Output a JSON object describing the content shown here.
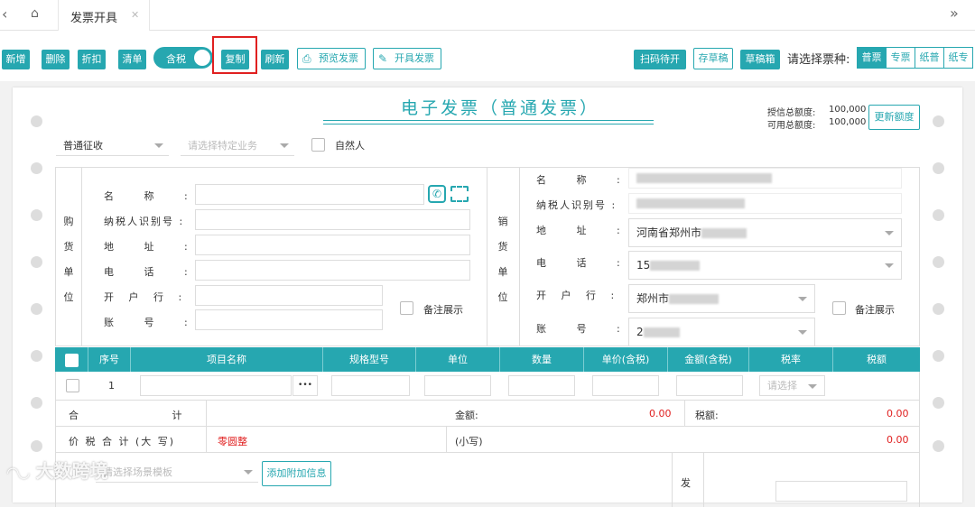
{
  "tabs": {
    "active_label": "发票开具"
  },
  "toolbar": {
    "add": "新增",
    "delete": "删除",
    "discount": "折扣",
    "list": "清单",
    "tax_toggle": "含税",
    "copy": "复制",
    "refresh": "刷新",
    "preview": "预览发票",
    "issue": "开具发票",
    "scan_pending": "扫码待开",
    "save_draft": "存草稿",
    "draft_box": "草稿箱",
    "ticket_type_label": "请选择票种:",
    "ticket_types": [
      "普票",
      "专票",
      "纸普",
      "纸专"
    ],
    "selected_ticket_type": "普票"
  },
  "invoice": {
    "title": "电子发票（普通发票）",
    "quota_credit_label": "授信总额度:",
    "quota_credit_value": "100,000",
    "quota_avail_label": "可用总额度:",
    "quota_avail_value": "100,000",
    "update_quota": "更新额度",
    "levy_type": "普通征收",
    "special_business_placeholder": "请选择特定业务",
    "natural_person": "自然人",
    "buyer": {
      "side_label": [
        "购",
        "货",
        "单",
        "位"
      ],
      "name_label": "名 称 :",
      "taxid_label": "纳税人识别号 :",
      "addr_label": "地 址 :",
      "phone_label": "电 话 :",
      "bank_label": "开 户 行 :",
      "acct_label": "账 号 :",
      "remark_show": "备注展示"
    },
    "seller": {
      "side_label": [
        "销",
        "货",
        "单",
        "位"
      ],
      "name_label": "名 称 :",
      "taxid_label": "纳税人识别号 :",
      "addr_label": "地 址 :",
      "phone_label": "电 话 :",
      "bank_label": "开 户 行 :",
      "acct_label": "账 号 :",
      "addr_value": "河南省郑州市",
      "phone_value": "15",
      "bank_value": "郑州市",
      "acct_value": "2",
      "remark_show": "备注展示"
    },
    "table": {
      "headers": [
        "序号",
        "项目名称",
        "规格型号",
        "单位",
        "数量",
        "单价(含税)",
        "金额(含税)",
        "税率",
        "税额"
      ],
      "row1_no": "1",
      "rate_placeholder": "请选择",
      "more": "•••"
    },
    "totals": {
      "total_label": "合 计",
      "amount_label": "金额:",
      "amount_value": "0.00",
      "tax_label": "税额:",
      "tax_value": "0.00",
      "grand_label": "价 税 合 计 (大 写)",
      "grand_upper": "零圆整",
      "small_label": "(小写)",
      "small_value": "0.00"
    },
    "scene_placeholder": "请选择场景模板",
    "add_extra_info": "添加附加信息",
    "issuer_label": "发"
  },
  "watermark": "大数跨境"
}
